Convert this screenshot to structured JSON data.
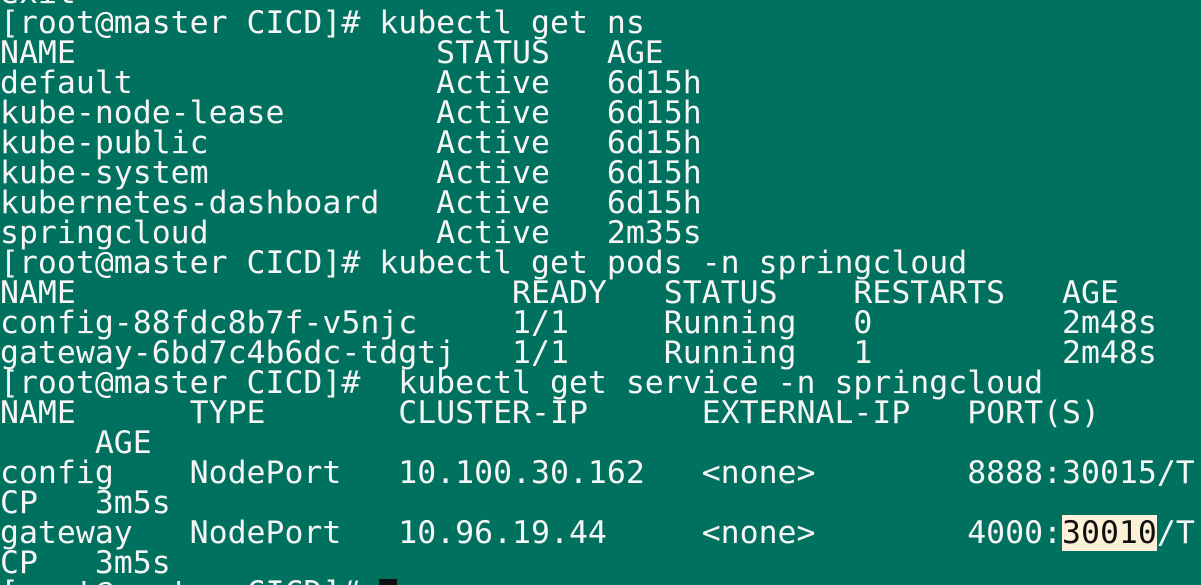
{
  "terminal": {
    "background": "#00715f",
    "foreground": "#f5f5f5",
    "highlight_background": "#fff1d8",
    "lines": [
      "exit",
      "[root@master CICD]# kubectl get ns",
      "NAME                   STATUS   AGE",
      "default                Active   6d15h",
      "kube-node-lease        Active   6d15h",
      "kube-public            Active   6d15h",
      "kube-system            Active   6d15h",
      "kubernetes-dashboard   Active   6d15h",
      "springcloud            Active   2m35s",
      "[root@master CICD]# kubectl get pods -n springcloud",
      "NAME                       READY   STATUS    RESTARTS   AGE",
      "config-88fdc8b7f-v5njc     1/1     Running   0          2m48s",
      "gateway-6bd7c4b6dc-tdgtj   1/1     Running   1          2m48s",
      "[root@master CICD]#  kubectl get service -n springcloud",
      "NAME      TYPE       CLUSTER-IP      EXTERNAL-IP   PORT(S)",
      "     AGE",
      "config    NodePort   10.100.30.162   <none>        8888:30015/T",
      "CP   3m5s",
      "gateway   NodePort   10.96.19.44     <none>        4000:",
      "CP   3m5s",
      "[root@master CICD]# "
    ],
    "selection": {
      "text": "30010",
      "after": "/T"
    }
  }
}
